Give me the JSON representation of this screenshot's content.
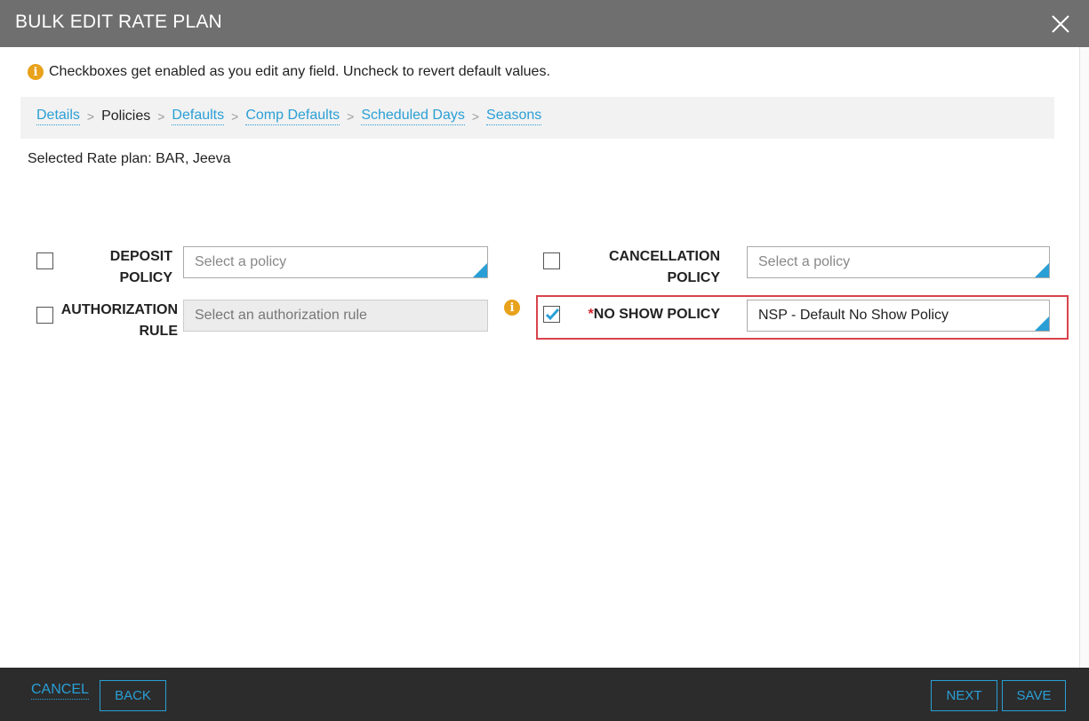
{
  "header": {
    "title": "BULK EDIT RATE PLAN",
    "close_icon": "close-icon"
  },
  "info": {
    "icon": "info-icon",
    "text": "Checkboxes get enabled as you edit any field. Uncheck to revert default values."
  },
  "breadcrumb": {
    "items": [
      {
        "label": "Details",
        "current": false
      },
      {
        "label": "Policies",
        "current": true
      },
      {
        "label": "Defaults",
        "current": false
      },
      {
        "label": "Comp Defaults",
        "current": false
      },
      {
        "label": "Scheduled Days",
        "current": false
      },
      {
        "label": "Seasons",
        "current": false
      }
    ],
    "separator": ">"
  },
  "selected_rate_plan": "Selected Rate plan: BAR, Jeeva",
  "policies": {
    "deposit": {
      "label_line1": "DEPOSIT",
      "label_line2": "POLICY",
      "placeholder": "Select a policy",
      "checked": false
    },
    "authorization": {
      "label_line1": "AUTHORIZATION",
      "label_line2": "RULE",
      "placeholder": "Select an authorization rule",
      "checked": false,
      "disabled": true
    },
    "cancellation": {
      "label_line1": "CANCELLATION",
      "label_line2": "POLICY",
      "placeholder": "Select a policy",
      "checked": false
    },
    "no_show": {
      "required_mark": "*",
      "label": "NO SHOW POLICY",
      "value": "NSP - Default No Show Policy",
      "checked": true
    }
  },
  "footer": {
    "cancel": "CANCEL",
    "back": "BACK",
    "next": "NEXT",
    "save": "SAVE"
  },
  "colors": {
    "accent": "#2a9fd6",
    "header_bg": "#6f6f6f",
    "footer_bg": "#2c2c2c",
    "highlight": "#d9434b",
    "info": "#e8a21b"
  }
}
